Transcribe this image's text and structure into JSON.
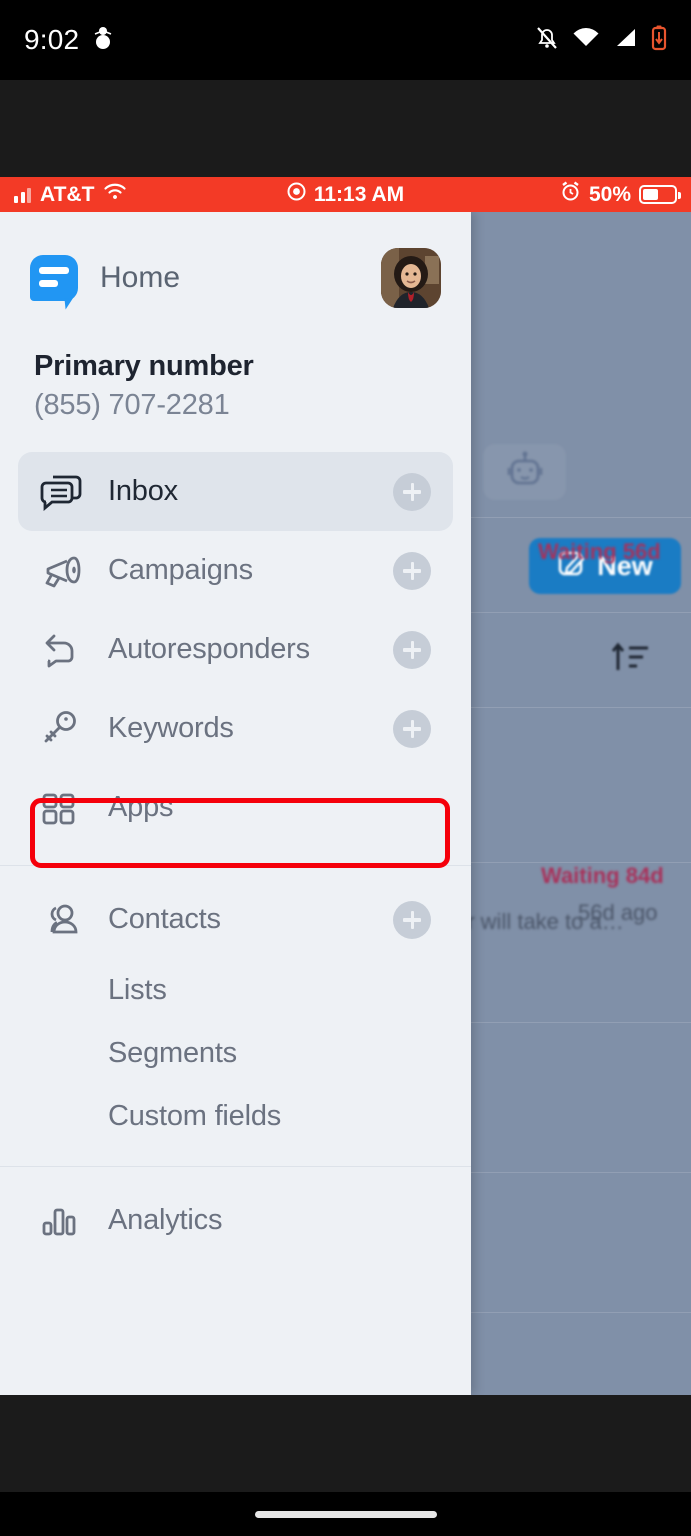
{
  "android_status": {
    "clock": "9:02",
    "icons": [
      "snowman-icon",
      "notifications-off-icon",
      "wifi-icon",
      "cell-signal-icon",
      "battery-low-icon"
    ]
  },
  "ios_status": {
    "carrier": "AT&T",
    "time": "11:13 AM",
    "battery_percent": "50%",
    "icons": [
      "cell-signal-icon",
      "wifi-icon",
      "screen-record-icon",
      "alarm-clock-icon",
      "battery-icon"
    ]
  },
  "drawer": {
    "logo_icon": "chat-bubble-logo-icon",
    "home_label": "Home",
    "avatar_icon": "user-avatar",
    "primary": {
      "title": "Primary number",
      "number": "(855) 707-2281"
    },
    "nav": [
      {
        "label": "Inbox",
        "icon": "chat-bubbles-icon",
        "has_plus": true,
        "active": true
      },
      {
        "label": "Campaigns",
        "icon": "megaphone-icon",
        "has_plus": true,
        "active": false,
        "highlighted": true
      },
      {
        "label": "Autoresponders",
        "icon": "reply-arrow-icon",
        "has_plus": true,
        "active": false
      },
      {
        "label": "Keywords",
        "icon": "key-icon",
        "has_plus": true,
        "active": false
      },
      {
        "label": "Apps",
        "icon": "grid-squares-icon",
        "has_plus": false,
        "active": false
      }
    ],
    "contacts_group": {
      "parent": {
        "label": "Contacts",
        "icon": "users-icon",
        "has_plus": true
      },
      "children": [
        {
          "label": "Lists"
        },
        {
          "label": "Segments"
        },
        {
          "label": "Custom fields"
        }
      ]
    },
    "analytics": {
      "label": "Analytics",
      "icon": "bar-chart-icon"
    }
  },
  "background": {
    "robot_button_icon": "robot-icon",
    "new_button": {
      "label": "New",
      "icon": "compose-icon"
    },
    "sort_icon": "sort-icon",
    "rows": [
      {
        "status": "Waiting 56d",
        "meta": ""
      },
      {
        "status": "",
        "meta": "56d ago"
      },
      {
        "status": "Waiting 84d",
        "meta": "er will take to a…"
      }
    ]
  },
  "colors": {
    "ios_bar_red": "#f33a26",
    "drawer_bg": "#eef1f5",
    "active_item_bg": "#dfe4eb",
    "overlay": "#8090a8",
    "accent_blue": "#2196f3",
    "annotation_red": "#f5000b",
    "waiting_red": "#a8315a"
  },
  "annotation": {
    "target": "Campaigns",
    "shape": "rectangle",
    "color": "#f5000b"
  }
}
